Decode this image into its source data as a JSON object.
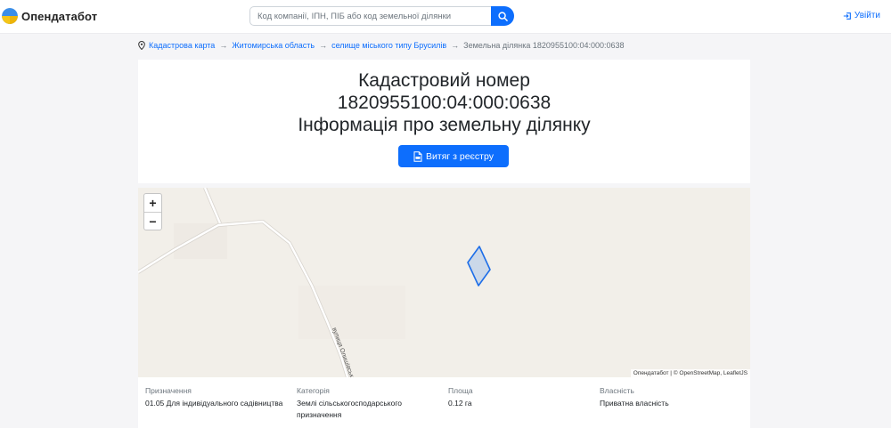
{
  "header": {
    "brand": "Опендатабот",
    "search_placeholder": "Код компанії, ІПН, ПІБ або код земельної ділянки",
    "login_label": "Увійти"
  },
  "breadcrumb": {
    "items": [
      "Кадастрова карта",
      "Житомирська область",
      "селище міського типу Брусилів"
    ],
    "current": "Земельна ділянка 1820955100:04:000:0638",
    "separator": "→"
  },
  "title": {
    "line1": "Кадастровий номер",
    "line2": "1820955100:04:000:0638",
    "line3": "Інформація про земельну ділянку"
  },
  "extract_button": "Витяг з реєстру",
  "map": {
    "zoom_in": "+",
    "zoom_out": "−",
    "attribution": "Опендатабот | © OpenStreetMap, LeafletJS",
    "street_label": "вулиця Олишівська",
    "parcel_color": "#1e6ee8"
  },
  "info": [
    {
      "label": "Призначення",
      "value": "01.05 Для індивідуального садівництва"
    },
    {
      "label": "Категорія",
      "value": "Землі сільськогосподарського призначення"
    },
    {
      "label": "Площа",
      "value": "0.12 га"
    },
    {
      "label": "Власність",
      "value": "Приватна власність"
    }
  ],
  "colors": {
    "accent": "#0d6efd",
    "page_bg": "#f5f5f7",
    "map_bg": "#f2efe9"
  }
}
